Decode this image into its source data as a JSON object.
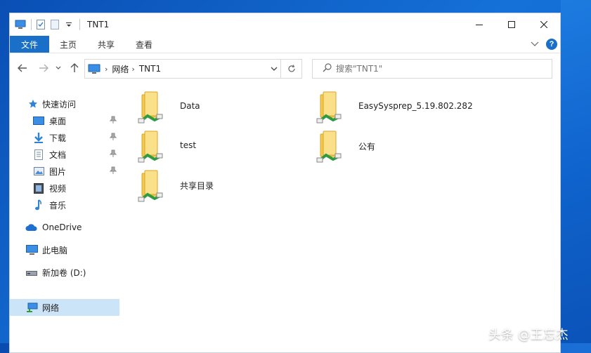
{
  "window": {
    "title": "TNT1"
  },
  "ribbon": {
    "file_label": "文件",
    "tabs": [
      {
        "label": "主页"
      },
      {
        "label": "共享"
      },
      {
        "label": "查看"
      }
    ]
  },
  "address": {
    "segments": [
      {
        "label": "网络"
      },
      {
        "label": "TNT1"
      }
    ]
  },
  "search": {
    "placeholder": "搜索\"TNT1\""
  },
  "sidebar": {
    "quick_access": "快速访问",
    "pinned": [
      {
        "label": "桌面",
        "icon": "desktop-icon"
      },
      {
        "label": "下载",
        "icon": "download-icon"
      },
      {
        "label": "文档",
        "icon": "document-icon"
      },
      {
        "label": "图片",
        "icon": "pictures-icon"
      }
    ],
    "libraries": [
      {
        "label": "视频",
        "icon": "video-icon"
      },
      {
        "label": "音乐",
        "icon": "music-icon"
      }
    ],
    "onedrive": "OneDrive",
    "this_pc": "此电脑",
    "drive": "新加卷 (D:)",
    "network": "网络"
  },
  "folders": [
    {
      "name": "Data"
    },
    {
      "name": "EasySysprep_5.19.802.282"
    },
    {
      "name": "test"
    },
    {
      "name": "公有"
    },
    {
      "name": "共享目录"
    }
  ],
  "watermark": "头条 @王忘杰",
  "colors": {
    "accent": "#1a6fc9",
    "selected": "#cce4f7",
    "folder": "#f5c94f",
    "share": "#2e9b3e"
  }
}
